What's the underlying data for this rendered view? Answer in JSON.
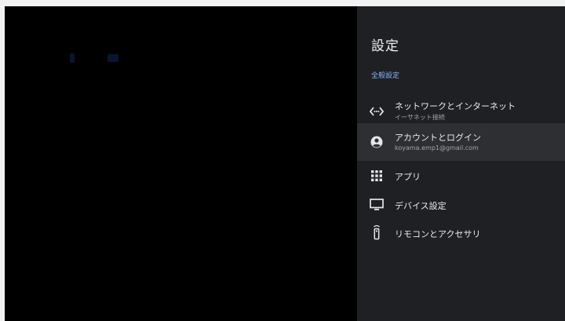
{
  "panel": {
    "title": "設定",
    "section": "全般設定",
    "items": [
      {
        "icon": "ethernet-icon",
        "label": "ネットワークとインターネット",
        "sub": "イーサネット接続"
      },
      {
        "icon": "account-icon",
        "label": "アカウントとログイン",
        "sub": "koyama.emp1@gmail.com"
      },
      {
        "icon": "apps-grid-icon",
        "label": "アプリ",
        "sub": ""
      },
      {
        "icon": "display-icon",
        "label": "デバイス設定",
        "sub": ""
      },
      {
        "icon": "remote-icon",
        "label": "リモコンとアクセサリ",
        "sub": ""
      }
    ]
  },
  "colors": {
    "panel_bg": "#1f2023",
    "selected_bg": "#2e2f32",
    "section_accent": "#8ab4f8",
    "screen_bg": "#000000"
  }
}
